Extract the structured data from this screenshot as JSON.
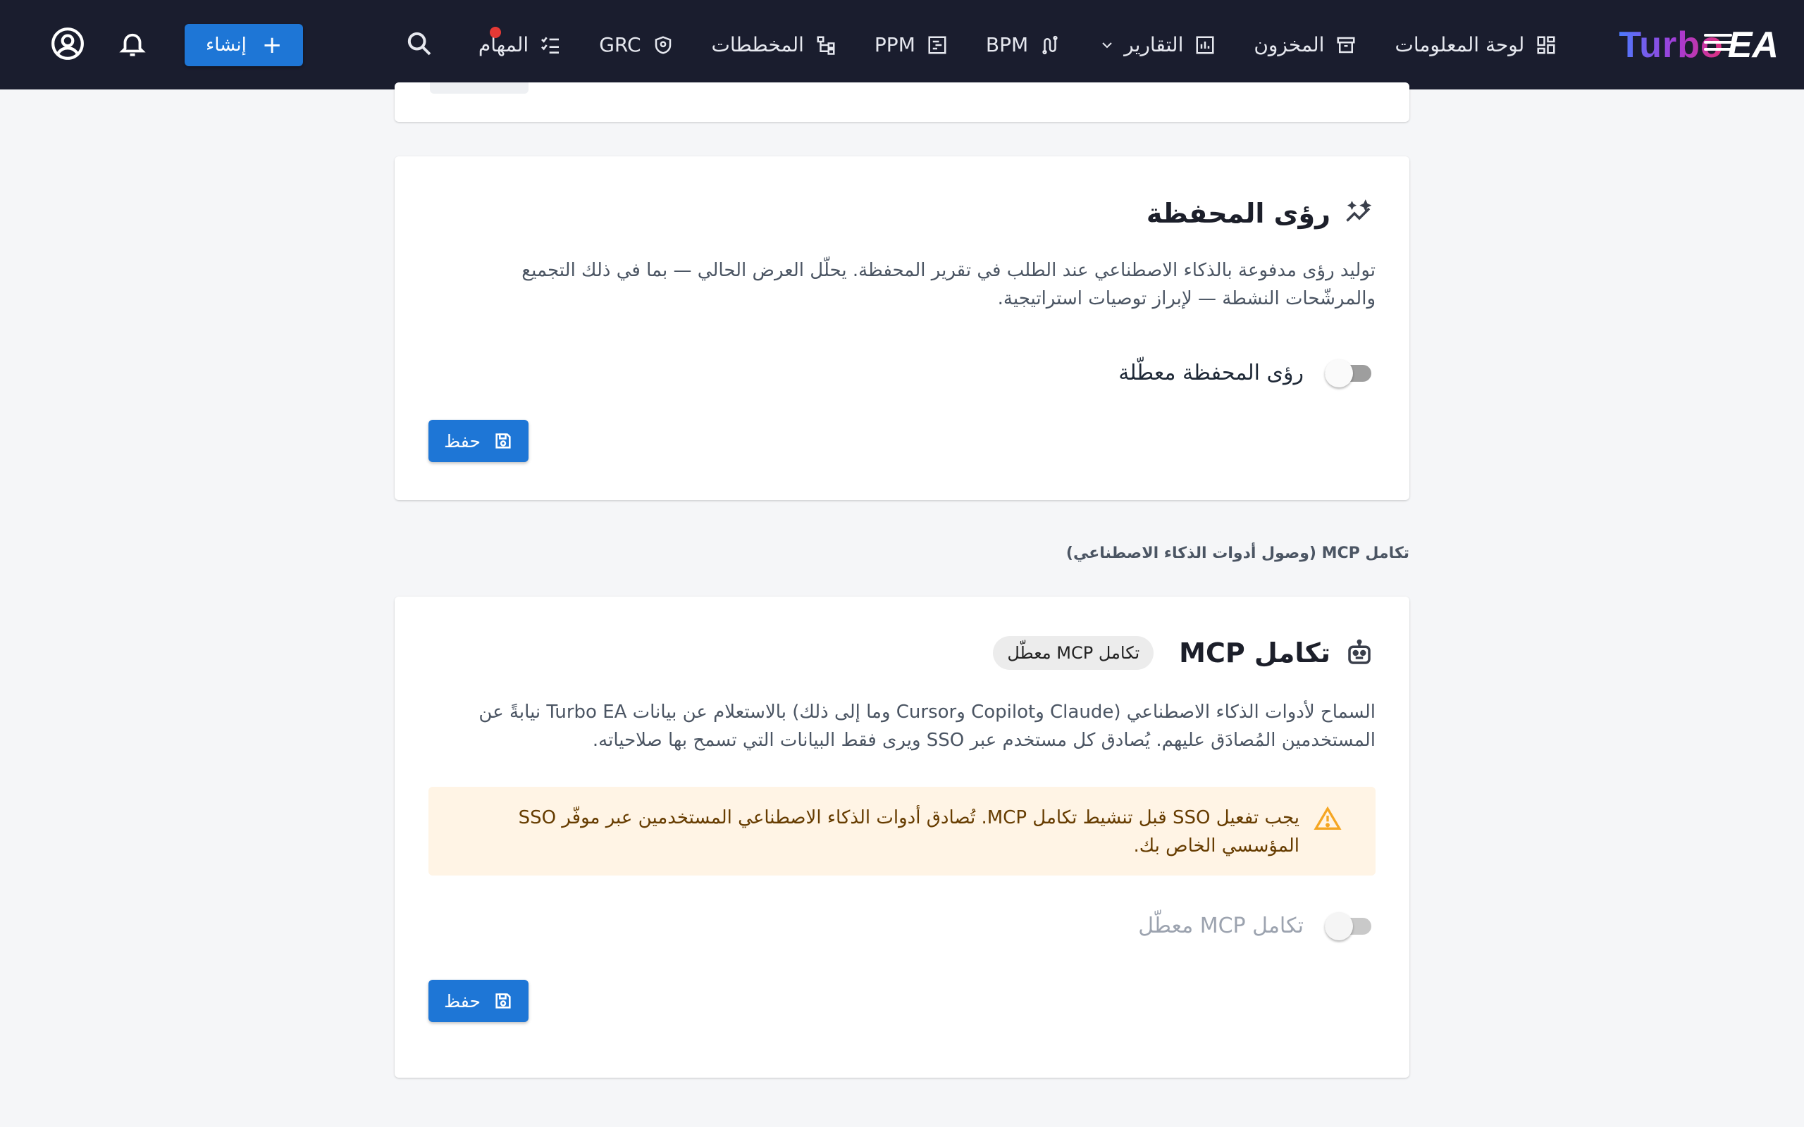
{
  "header": {
    "brand_prefix": "Turbo",
    "brand_suffix": "EA",
    "nav": [
      {
        "label": "لوحة المعلومات",
        "icon": "dashboard-icon"
      },
      {
        "label": "المخزون",
        "icon": "inventory-icon"
      },
      {
        "label": "التقارير",
        "icon": "reports-icon"
      },
      {
        "label": "BPM",
        "icon": "bpm-icon"
      },
      {
        "label": "PPM",
        "icon": "ppm-icon"
      },
      {
        "label": "المخططات",
        "icon": "diagrams-icon"
      },
      {
        "label": "GRC",
        "icon": "grc-shield-icon"
      },
      {
        "label": "المهام",
        "icon": "tasks-icon"
      }
    ],
    "create_label": "إنشاء",
    "create_icon": "plus-icon"
  },
  "portfolio_insights": {
    "title": "رؤى المحفظة",
    "description": "توليد رؤى مدفوعة بالذكاء الاصطناعي عند الطلب في تقرير المحفظة. يحلّل العرض الحالي — بما في ذلك التجميع والمرشّحات النشطة — لإبراز توصيات استراتيجية.",
    "toggle_label": "رؤى المحفظة معطّلة",
    "toggle_on": false,
    "save_label": "حفظ"
  },
  "section_label": "تكامل MCP (وصول أدوات الذكاء الاصطناعي)",
  "mcp": {
    "title": "تكامل MCP",
    "status_chip": "تكامل MCP معطّل",
    "description": "السماح لأدوات الذكاء الاصطناعي (Claude وCopilot وCursor وما إلى ذلك) بالاستعلام عن بيانات Turbo EA نيابةً عن المستخدمين المُصادَق عليهم. يُصادق كل مستخدم عبر SSO ويرى فقط البيانات التي تسمح بها صلاحياته.",
    "warning": "يجب تفعيل SSO قبل تنشيط تكامل MCP. تُصادق أدوات الذكاء الاصطناعي المستخدمين عبر موفّر SSO المؤسسي الخاص بك.",
    "toggle_label": "تكامل MCP معطّل",
    "toggle_on": false,
    "toggle_disabled": true,
    "save_label": "حفظ"
  },
  "colors": {
    "topbar": "#1a1d2e",
    "primary": "#1e76d6",
    "warning_bg": "#fff4e5",
    "warning_icon": "#f5a623",
    "notification_dot": "#e53935"
  }
}
